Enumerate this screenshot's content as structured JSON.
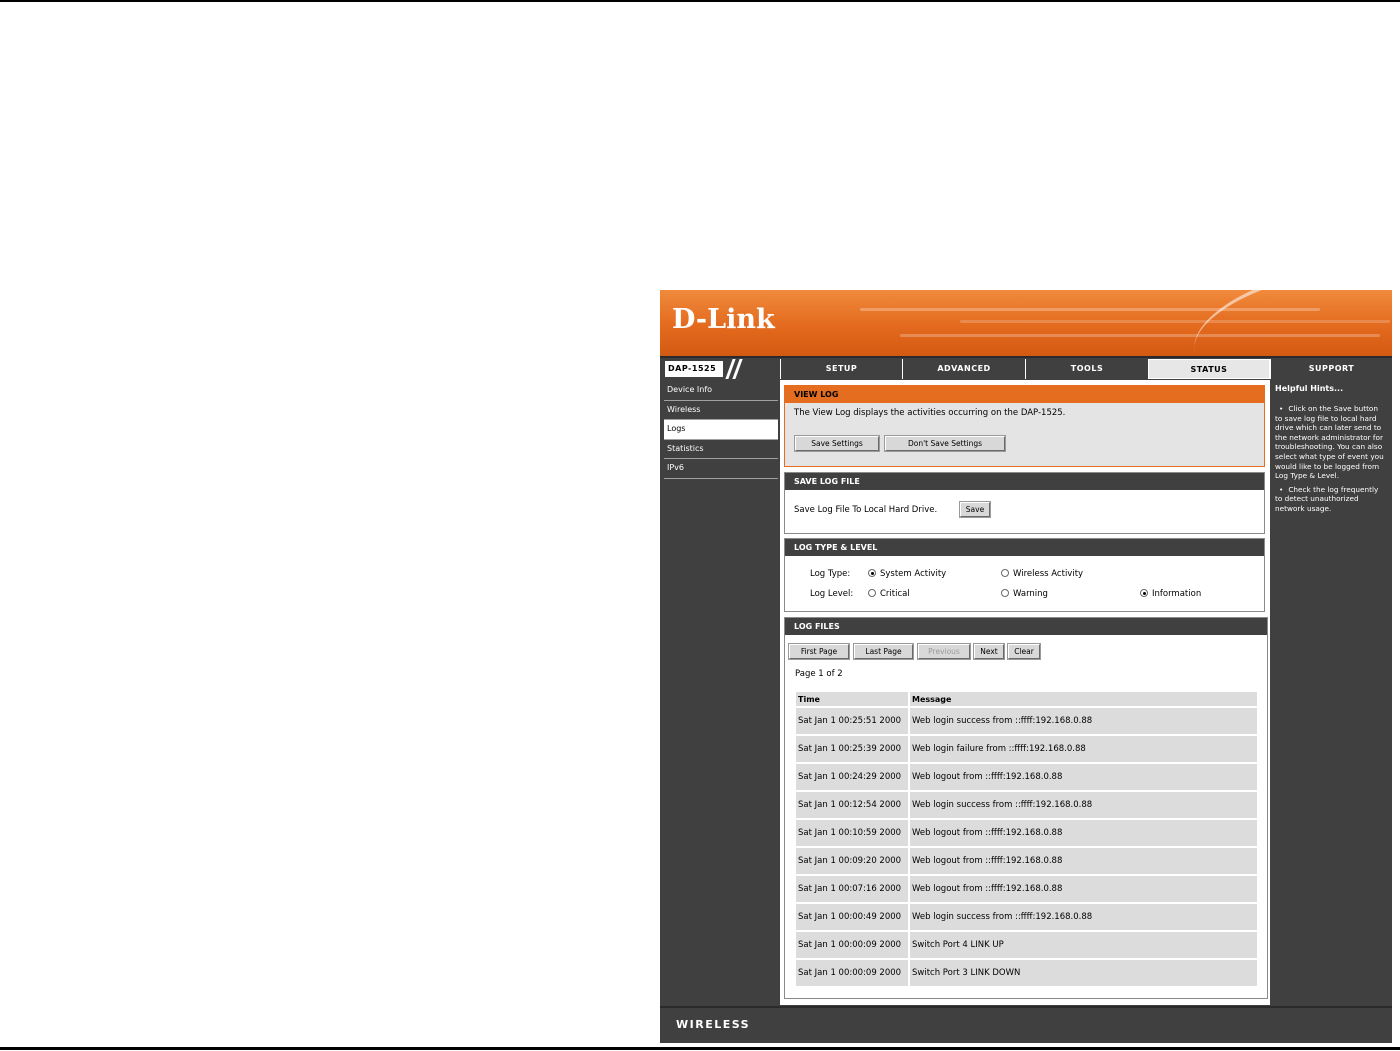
{
  "brand": {
    "logo": "D-Link",
    "model": "DAP-1525",
    "footer": "WIRELESS"
  },
  "nav": {
    "tabs": [
      {
        "label": "SETUP"
      },
      {
        "label": "ADVANCED"
      },
      {
        "label": "TOOLS"
      },
      {
        "label": "STATUS",
        "active": true
      },
      {
        "label": "SUPPORT"
      }
    ]
  },
  "sidebar": {
    "items": [
      {
        "label": "Device Info"
      },
      {
        "label": "Wireless"
      },
      {
        "label": "Logs",
        "active": true
      },
      {
        "label": "Statistics"
      },
      {
        "label": "IPv6"
      }
    ]
  },
  "view_log": {
    "title": "VIEW LOG",
    "description": "The View Log displays the activities occurring on the DAP-1525.",
    "save_settings": "Save Settings",
    "dont_save_settings": "Don't Save Settings"
  },
  "save_log_file": {
    "title": "SAVE LOG FILE",
    "label": "Save Log File To Local Hard Drive.",
    "save_button": "Save"
  },
  "log_type_level": {
    "title": "LOG TYPE & LEVEL",
    "type_label": "Log Type:",
    "level_label": "Log Level:",
    "types": [
      {
        "label": "System Activity",
        "checked": true
      },
      {
        "label": "Wireless Activity",
        "checked": false
      }
    ],
    "levels": [
      {
        "label": "Critical",
        "checked": false
      },
      {
        "label": "Warning",
        "checked": false
      },
      {
        "label": "Information",
        "checked": true
      }
    ]
  },
  "log_files": {
    "title": "LOG FILES",
    "buttons": {
      "first_page": "First Page",
      "last_page": "Last Page",
      "previous": "Previous",
      "next": "Next",
      "clear": "Clear"
    },
    "page_info": "Page 1 of 2",
    "columns": {
      "time": "Time",
      "message": "Message"
    },
    "rows": [
      {
        "time": "Sat Jan 1 00:25:51 2000",
        "message": "Web login success from ::ffff:192.168.0.88"
      },
      {
        "time": "Sat Jan 1 00:25:39 2000",
        "message": "Web login failure from ::ffff:192.168.0.88"
      },
      {
        "time": "Sat Jan 1 00:24:29 2000",
        "message": "Web logout from ::ffff:192.168.0.88"
      },
      {
        "time": "Sat Jan 1 00:12:54 2000",
        "message": "Web login success from ::ffff:192.168.0.88"
      },
      {
        "time": "Sat Jan 1 00:10:59 2000",
        "message": "Web logout from ::ffff:192.168.0.88"
      },
      {
        "time": "Sat Jan 1 00:09:20 2000",
        "message": "Web logout from ::ffff:192.168.0.88"
      },
      {
        "time": "Sat Jan 1 00:07:16 2000",
        "message": "Web logout from ::ffff:192.168.0.88"
      },
      {
        "time": "Sat Jan 1 00:00:49 2000",
        "message": "Web login success from ::ffff:192.168.0.88"
      },
      {
        "time": "Sat Jan 1 00:00:09 2000",
        "message": "Switch Port 4 LINK UP"
      },
      {
        "time": "Sat Jan 1 00:00:09 2000",
        "message": "Switch Port 3 LINK DOWN"
      }
    ]
  },
  "hints": {
    "title": "Helpful Hints...",
    "items": [
      "Click on the Save button to save log file to local hard drive which can later send to the network administrator for troubleshooting. You can also select what type of event you would like to be logged from Log Type & Level.",
      "Check the log frequently to detect unauthorized network usage."
    ]
  },
  "colors": {
    "accent": "#e46d1f",
    "dark": "#404040",
    "panel": "#e4e4e4"
  }
}
